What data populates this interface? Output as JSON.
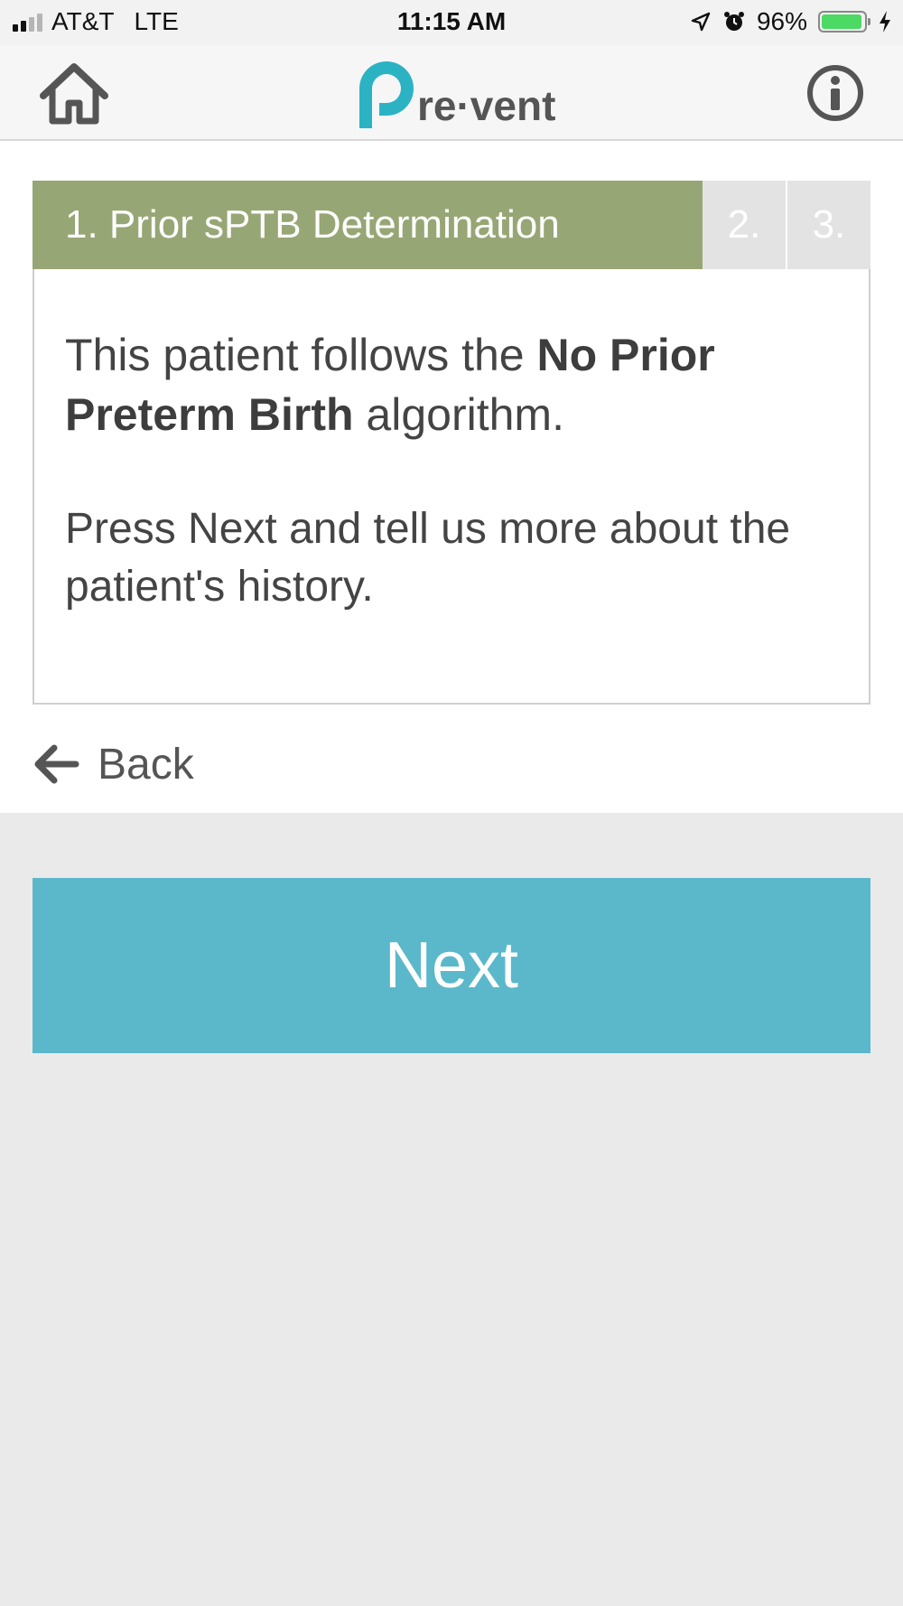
{
  "status_bar": {
    "carrier": "AT&T",
    "network": "LTE",
    "time": "11:15 AM",
    "battery": "96%",
    "battery_level": 0.96,
    "battery_color": "#4cd964"
  },
  "nav": {
    "logo_text": "re·vent",
    "logo_letter": "P",
    "logo_color": "#2bb3c4"
  },
  "steps": {
    "active_label": "1. Prior sPTB Determination",
    "step2": "2.",
    "step3": "3.",
    "active_color": "#97a675"
  },
  "message": {
    "line1_pre": "This patient follows the ",
    "line1_bold": "No Prior Preterm Birth",
    "line1_post": " algorithm.",
    "line2": "Press Next and tell us more about the patient's history."
  },
  "back": {
    "label": "Back"
  },
  "next": {
    "label": "Next",
    "color": "#5bb8ca"
  }
}
